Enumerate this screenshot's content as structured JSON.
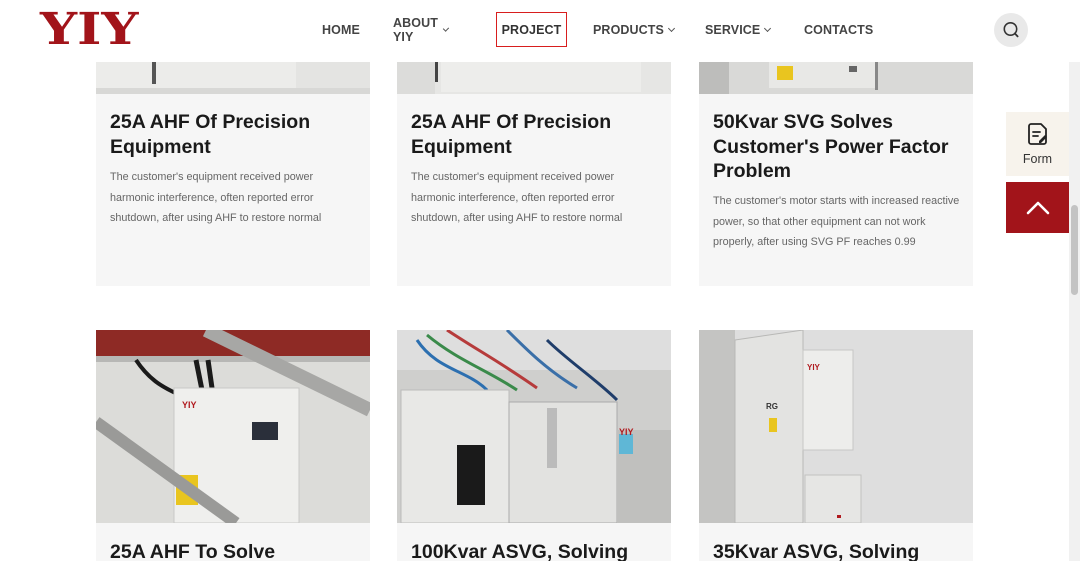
{
  "brand": {
    "logo_text": "YIY",
    "color": "#a2141a"
  },
  "nav": {
    "items": [
      {
        "label": "HOME",
        "has_dropdown": false
      },
      {
        "label": "ABOUT YIY",
        "has_dropdown": true
      },
      {
        "label": "PROJECT",
        "has_dropdown": false,
        "active": true
      },
      {
        "label": "PRODUCTS",
        "has_dropdown": true
      },
      {
        "label": "SERVICE",
        "has_dropdown": true
      },
      {
        "label": "CONTACTS",
        "has_dropdown": false
      }
    ],
    "search_icon": "search-icon"
  },
  "projects": [
    {
      "title": "25A AHF Of Precision Equipment",
      "description": "The customer's equipment received power harmonic interference, often reported error shutdown, after using AHF to restore normal"
    },
    {
      "title": "25A AHF Of Precision Equipment",
      "description": "The customer's equipment received power harmonic interference, often reported error shutdown, after using AHF to restore normal"
    },
    {
      "title": "50Kvar SVG Solves Customer's Power Factor Problem",
      "description": "The customer's motor starts with increased reactive power, so that other equipment can not work properly, after using SVG PF reaches 0.99"
    },
    {
      "title": "25A AHF To Solve",
      "image_logo": "YIY"
    },
    {
      "title": "100Kvar ASVG, Solving",
      "image_logo": "YIY"
    },
    {
      "title": "35Kvar ASVG, Solving",
      "image_logo": "YIY",
      "image_tag": "RG"
    }
  ],
  "side": {
    "form_label": "Form",
    "form_icon": "form-document-icon",
    "top_icon": "chevron-up-icon"
  },
  "colors": {
    "accent": "#a2141a",
    "active_border": "#d81e1e",
    "card_bg": "#f6f6f6"
  }
}
